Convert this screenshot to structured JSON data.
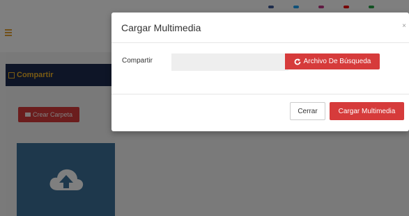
{
  "page": {
    "sidebar_header": "Compartir",
    "create_folder_label": "Crear Carpeta"
  },
  "modal": {
    "title": "Cargar Multimedia",
    "close_symbol": "×",
    "share_label": "Compartir",
    "browse_label": "Archivo De Búsqueda",
    "close_button": "Cerrar",
    "upload_button": "Cargar Multimedia"
  },
  "icons": {
    "refresh": "refresh-icon",
    "folder": "folder-icon",
    "cloud_upload": "cloud-upload-icon",
    "menu": "hamburger-icon",
    "film": "film-icon"
  },
  "colors": {
    "accent_red": "#d63b3b",
    "navy": "#1d2a4f",
    "gold": "#f0b429",
    "card_blue": "#3d7098"
  }
}
